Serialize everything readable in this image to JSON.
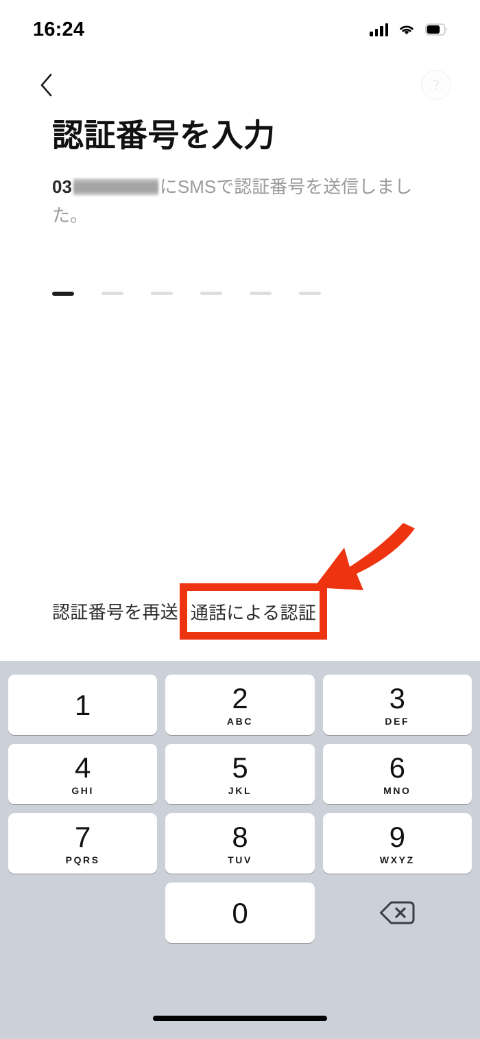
{
  "status_bar": {
    "time": "16:24",
    "signal_icon": "cellular-signal-icon",
    "wifi_icon": "wifi-icon",
    "battery_icon": "battery-icon",
    "battery_level_percent": 70,
    "signal_bars": 4
  },
  "nav": {
    "back_icon": "chevron-left-icon",
    "help_label": "?",
    "help_icon": "question-mark-icon"
  },
  "main": {
    "title": "認証番号を入力",
    "description_prefix": "03",
    "description_redacted": "",
    "description_suffix": "にSMSで認証番号を送信しました。"
  },
  "code_input": {
    "length": 6,
    "filled_count": 1,
    "dashes": [
      {
        "filled": true
      },
      {
        "filled": false
      },
      {
        "filled": false
      },
      {
        "filled": false
      },
      {
        "filled": false
      },
      {
        "filled": false
      }
    ]
  },
  "actions": {
    "resend_label": "認証番号を再送",
    "call_verify_label": "通話による認証"
  },
  "annotation": {
    "highlight_color": "#ee3311",
    "arrow_icon": "arrow-down-left-icon",
    "target": "通話による認証"
  },
  "keyboard": {
    "background_color": "#ccd0d9",
    "key_color": "#ffffff",
    "rows": [
      [
        {
          "digit": "1",
          "letters": ""
        },
        {
          "digit": "2",
          "letters": "ABC"
        },
        {
          "digit": "3",
          "letters": "DEF"
        }
      ],
      [
        {
          "digit": "4",
          "letters": "GHI"
        },
        {
          "digit": "5",
          "letters": "JKL"
        },
        {
          "digit": "6",
          "letters": "MNO"
        }
      ],
      [
        {
          "digit": "7",
          "letters": "PQRS"
        },
        {
          "digit": "8",
          "letters": "TUV"
        },
        {
          "digit": "9",
          "letters": "WXYZ"
        }
      ],
      [
        {
          "digit": "",
          "letters": ""
        },
        {
          "digit": "0",
          "letters": ""
        },
        {
          "digit": "",
          "letters": "",
          "icon": "backspace-icon"
        }
      ]
    ]
  },
  "home_indicator": {
    "icon": "home-indicator"
  }
}
